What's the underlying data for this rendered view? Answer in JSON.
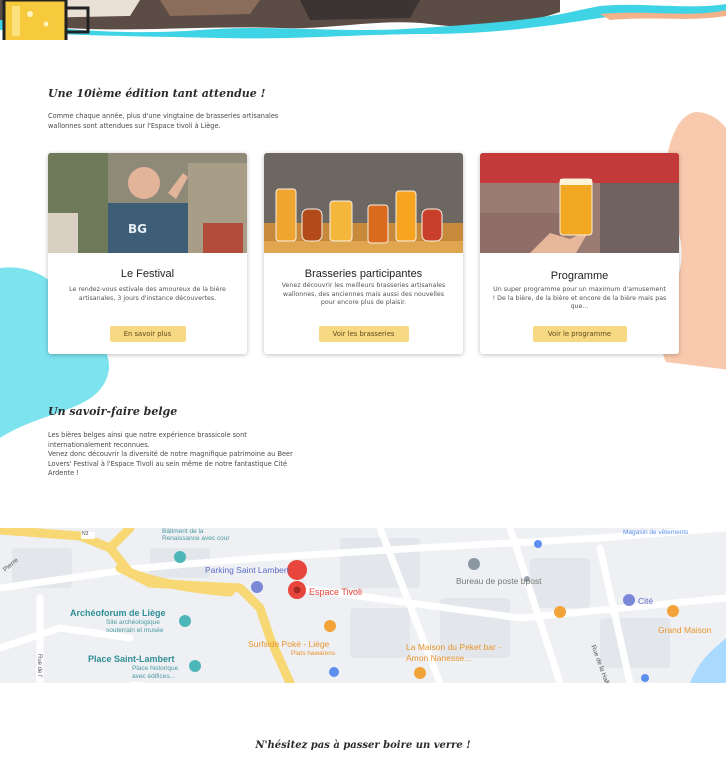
{
  "intro": {
    "title": "Une 10ième édition  tant attendue !",
    "text": "Comme chaque année, plus d'une vingtaine de brasseries artisanales wallonnes sont attendues sur l'Espace tivoli à Liège."
  },
  "cards": [
    {
      "title": "Le Festival",
      "description": "Le rendez-vous estivale des amoureux de la bière artisanales, 3 jours d'instance découvertes.",
      "button": "En savoir plus"
    },
    {
      "title": "Brasseries participantes",
      "description": "Venez découvrir les meilleurs brasseries artisanales wallonnes, des anciennes mais aussi des nouvelles pour encore plus de plaisir.",
      "button": "Voir les brasseries"
    },
    {
      "title": "Programme",
      "description": "Un super programme pour un maximum d'amusement ! De la bière, de la bière et encore de la bière mais pas que...",
      "button": "Voir le programme"
    }
  ],
  "savoir": {
    "title": "Un savoir-faire belge",
    "text1": "Les bières belges ainsi que notre expérience brassicole sont internationalement reconnues.",
    "text2": "Venez donc découvrir la diversité de notre magnifique patrimoine au Beer Lovers' Festival à l'Espace Tivoli au sein même de notre fantastique Cité Ardente !"
  },
  "map": {
    "road_n3_a": "N3",
    "road_n3_b": "N3",
    "batiment": "Bâtiment de la\nRenaissance avec cour",
    "parking": "Parking Saint Lambert",
    "espace_tivoli": "Espace Tivoli",
    "archeoforum": "Archéoforum de Liège",
    "archeoforum_sub": "Site archéologique\nsouterrain et musée",
    "place_stlambert": "Place Saint-Lambert",
    "place_sub": "Place historique\navec édifices...",
    "surfside": "Surfside Poké - Liège",
    "surfside_sub": "Plats hawaïens",
    "bureau_poste": "Bureau de poste bpost",
    "maison_peket": "La Maison du Peket bar -\nAmon Nanesse...",
    "magasin": "Magasin de vêtements",
    "cite": "Cité",
    "grand_maison": "Grand Maison",
    "rue_halle": "Rue de la Halle",
    "rue_pierre": "Pierre",
    "rue_dl": "Rue de l'"
  },
  "footer": {
    "title": "N'hésitez pas à passer boire un verre !"
  },
  "colors": {
    "cyan": "#7de3ee",
    "peach": "#f9c9ae",
    "button": "#f8d983",
    "map_road": "#f8d775"
  }
}
